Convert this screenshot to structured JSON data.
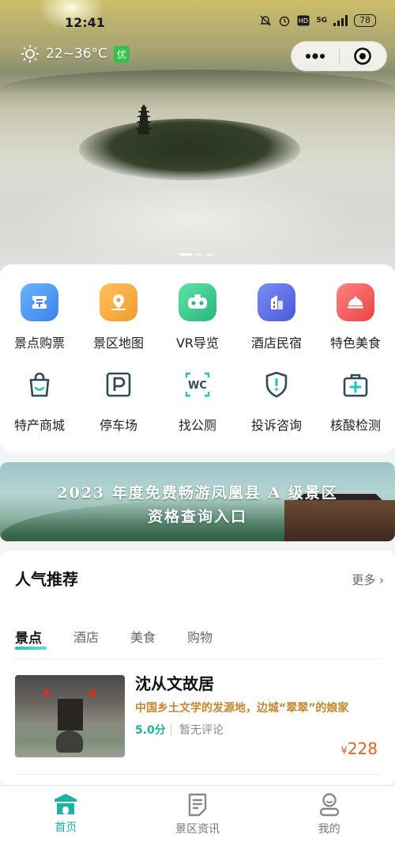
{
  "status": {
    "time": "12:41",
    "battery": "78",
    "network": "5G"
  },
  "weather": {
    "temp": "22~36°C",
    "aqi": "优"
  },
  "capsule": {
    "more_icon": "more-dots-icon",
    "close_icon": "target-circle-icon"
  },
  "services": [
    {
      "label": "景点购票",
      "icon": "ticket-icon",
      "color": "#4a9bf0"
    },
    {
      "label": "景区地图",
      "icon": "map-pin-icon",
      "color": "#f4a63a"
    },
    {
      "label": "VR导览",
      "icon": "vr-headset-icon",
      "color": "#34c88e"
    },
    {
      "label": "酒店民宿",
      "icon": "hotel-icon",
      "color": "#5a6ee8"
    },
    {
      "label": "特色美食",
      "icon": "food-cloche-icon",
      "color": "#ef5a5a"
    },
    {
      "label": "特产商城",
      "icon": "shopping-bag-icon",
      "color": "#3a8fb5"
    },
    {
      "label": "停车场",
      "icon": "parking-icon",
      "color": "#3a8fb5"
    },
    {
      "label": "找公厕",
      "icon": "wc-icon",
      "color": "#3a8fb5"
    },
    {
      "label": "投诉咨询",
      "icon": "shield-alert-icon",
      "color": "#3a8fb5"
    },
    {
      "label": "核酸检测",
      "icon": "medical-kit-icon",
      "color": "#3a8fb5"
    }
  ],
  "banner": {
    "line1": "2023 年度免费畅游凤凰县 A 级景区",
    "line2": "资格查询入口"
  },
  "recommend": {
    "title": "人气推荐",
    "more": "更多",
    "tabs": [
      "景点",
      "酒店",
      "美食",
      "购物"
    ],
    "items": [
      {
        "name": "沈从文故居",
        "desc": "中国乡土文学的发源地，边城“翠翠”的娘家",
        "score": "5.0分",
        "reviews": "暂无评论",
        "price": "228",
        "currency": "¥"
      }
    ]
  },
  "nav": [
    {
      "label": "首页",
      "icon": "home-icon",
      "active": true
    },
    {
      "label": "景区资讯",
      "icon": "news-icon",
      "active": false
    },
    {
      "label": "我的",
      "icon": "user-icon",
      "active": false
    }
  ],
  "colors": {
    "accent": "#1ab3a5",
    "price": "#e0622a",
    "desc": "#c8862a"
  }
}
